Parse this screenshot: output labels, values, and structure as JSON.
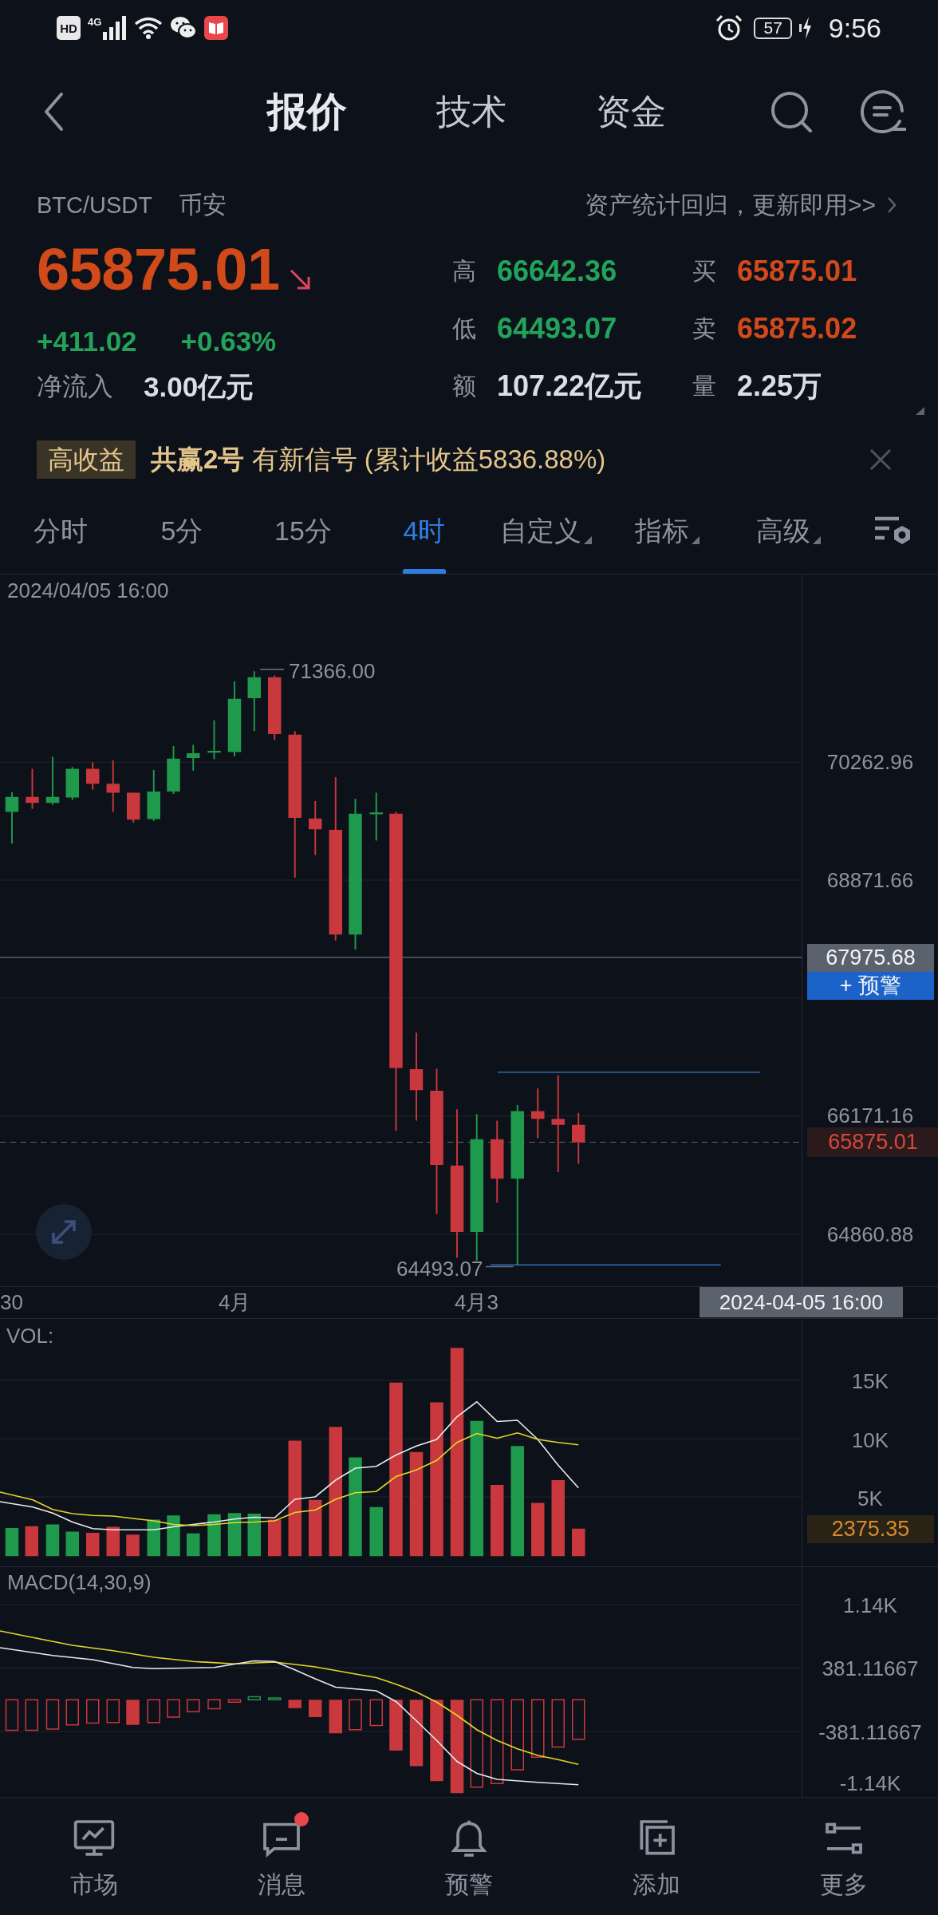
{
  "status_bar": {
    "hd_badge": "HD",
    "network": "4G",
    "battery": "57",
    "time": "9:56"
  },
  "header": {
    "tabs": [
      {
        "label": "报价",
        "selected": true
      },
      {
        "label": "技术",
        "selected": false
      },
      {
        "label": "资金",
        "selected": false
      }
    ]
  },
  "quote": {
    "pair": "BTC/USDT",
    "exchange": "币安",
    "promo_link": "资产统计回归，更新即用>>",
    "price": "65875.01",
    "price_down": true,
    "change": "+411.02",
    "change_percent": "+0.63%",
    "change_up": true,
    "net_inflow_label": "净流入",
    "net_inflow": "3.00亿元",
    "stats": [
      {
        "label": "高",
        "value": "66642.36",
        "color": "#23a35a"
      },
      {
        "label": "买",
        "value": "65875.01",
        "color": "#d24a1c"
      },
      {
        "label": "低",
        "value": "64493.07",
        "color": "#23a35a"
      },
      {
        "label": "卖",
        "value": "65875.02",
        "color": "#d24a1c"
      },
      {
        "label": "额",
        "value": "107.22亿元",
        "color": "#d9dde4"
      },
      {
        "label": "量",
        "value": "2.25万",
        "color": "#d9dde4"
      }
    ]
  },
  "banner": {
    "tag": "高收益",
    "message": "**共赢2号** 有新信号 (累计收益5836.88%)"
  },
  "period_tabs": [
    {
      "label": "分时",
      "selected": false,
      "dropdown": false
    },
    {
      "label": "5分",
      "selected": false,
      "dropdown": false
    },
    {
      "label": "15分",
      "selected": false,
      "dropdown": false
    },
    {
      "label": "4时",
      "selected": true,
      "dropdown": false
    },
    {
      "label": "自定义",
      "selected": false,
      "dropdown": true
    },
    {
      "label": "指标",
      "selected": false,
      "dropdown": true
    },
    {
      "label": "高级",
      "selected": false,
      "dropdown": true
    }
  ],
  "chart": {
    "timestamp": "2024/04/05 16:00",
    "high_label": "71366.00",
    "low_label": "64493.07",
    "price_axis": [
      "70262.96",
      "68871.66",
      "66171.16",
      "64860.88"
    ],
    "crosshair_price": "67975.68",
    "alert_button": "+ 预警",
    "last_price": "65875.01",
    "x_axis": [
      "30",
      "4月",
      "4月3"
    ],
    "crosshair_time": "2024-04-05 16:00",
    "volume": {
      "title": "VOL:",
      "axis": [
        "15K",
        "10K",
        "5K"
      ],
      "current": "2375.35"
    },
    "macd": {
      "title": "MACD(14,30,9)",
      "axis": [
        "1.14K",
        "381.11667",
        "-381.11667",
        "-1.14K"
      ]
    }
  },
  "bottom_nav": [
    {
      "label": "市场",
      "badge": false
    },
    {
      "label": "消息",
      "badge": true
    },
    {
      "label": "预警",
      "badge": false
    },
    {
      "label": "添加",
      "badge": false
    },
    {
      "label": "更多",
      "badge": false
    }
  ]
}
